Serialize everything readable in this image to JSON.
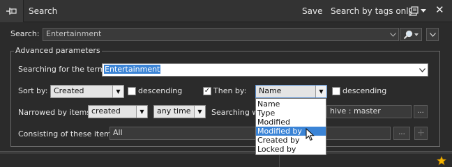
{
  "titlebar": {
    "title": "Search",
    "save_label": "Save",
    "search_by_tags_label": "Search by tags only",
    "close_glyph": "✕",
    "pin_icon": "pin-icon",
    "options_icon": "options-icon"
  },
  "search": {
    "label": "Search:",
    "value": "Entertainment"
  },
  "advanced": {
    "legend": "Advanced parameters",
    "terms_label": "Searching for the terms:",
    "terms_value": "Entertainment",
    "sort_by_label": "Sort by:",
    "sort_by_value": "Created",
    "descending_label": "descending",
    "then_by_label": "Then by:",
    "then_by_value": "Name",
    "then_by_checked": true,
    "then_descending_label": "descending",
    "narrowed_label": "Narrowed by items:",
    "narrowed_value": "created",
    "time_value": "any time",
    "searching_within_label": "Searching wi",
    "searching_within_value": "hive : master",
    "consisting_label": "Consisting of these items:",
    "consisting_value": "All",
    "browse_label": "...",
    "add_label": "+"
  },
  "dropdown": {
    "items": [
      "Name",
      "Type",
      "Modified",
      "Modified by",
      "Created by",
      "Locked by"
    ],
    "selected": "Modified by"
  },
  "colors": {
    "accent": "#3b84d6",
    "star": "#f5b400"
  }
}
